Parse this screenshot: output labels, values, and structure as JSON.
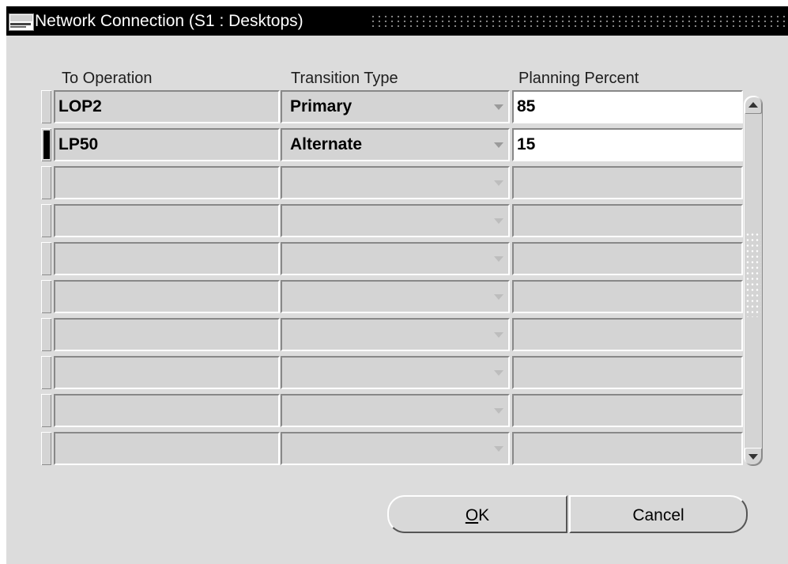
{
  "window": {
    "title": "Network Connection (S1 : Desktops)"
  },
  "table": {
    "headers": [
      "To Operation",
      "Transition Type",
      "Planning Percent"
    ],
    "rows": [
      {
        "to_operation": "LOP2",
        "transition_type": "Primary",
        "planning_percent": "85"
      },
      {
        "to_operation": "LP50",
        "transition_type": "Alternate",
        "planning_percent": "15"
      },
      {
        "to_operation": "",
        "transition_type": "",
        "planning_percent": ""
      },
      {
        "to_operation": "",
        "transition_type": "",
        "planning_percent": ""
      },
      {
        "to_operation": "",
        "transition_type": "",
        "planning_percent": ""
      },
      {
        "to_operation": "",
        "transition_type": "",
        "planning_percent": ""
      },
      {
        "to_operation": "",
        "transition_type": "",
        "planning_percent": ""
      },
      {
        "to_operation": "",
        "transition_type": "",
        "planning_percent": ""
      },
      {
        "to_operation": "",
        "transition_type": "",
        "planning_percent": ""
      },
      {
        "to_operation": "",
        "transition_type": "",
        "planning_percent": ""
      }
    ],
    "current_row": 2
  },
  "buttons": {
    "ok_mnemonic": "O",
    "ok_rest": "K",
    "cancel": "Cancel"
  },
  "icons": {
    "app_logo": "oracle-applications-logo-icon",
    "dropdown": "chevron-down-icon",
    "scroll_up": "scroll-up-arrow-icon",
    "scroll_down": "scroll-down-arrow-icon"
  },
  "colors": {
    "window_bg": "#dcdcdc",
    "titlebar_bg": "#000000",
    "cell_bg": "#d4d4d4",
    "active_cell_bg": "#ffffff"
  }
}
